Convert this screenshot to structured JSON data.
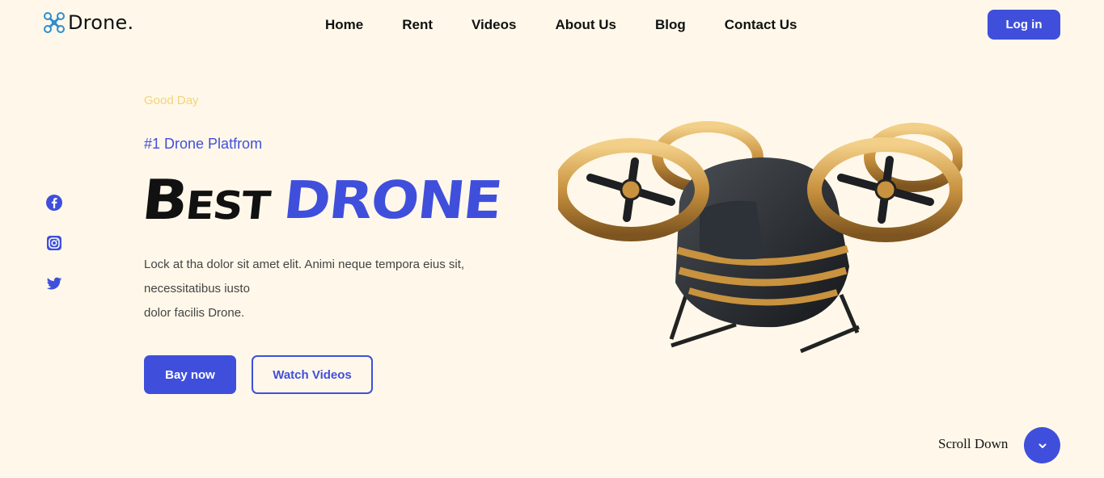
{
  "header": {
    "logo_text": "Drone.",
    "nav": [
      "Home",
      "Rent",
      "Videos",
      "About Us",
      "Blog",
      "Contact Us"
    ],
    "login_label": "Log in"
  },
  "social": [
    "facebook-icon",
    "instagram-icon",
    "twitter-icon"
  ],
  "hero": {
    "greeting": "Good Day",
    "tagline": "#1 Drone Platfrom",
    "headline_black": "Best",
    "headline_blue": "DRONE",
    "description_lines": [
      "Lock at tha dolor sit amet elit. Animi neque tempora eius sit,",
      "necessitatibus iusto",
      "dolor facilis Drone."
    ],
    "primary_button": "Bay now",
    "secondary_button": "Watch Videos"
  },
  "scroll": {
    "label": "Scroll Down"
  },
  "colors": {
    "accent": "#3f4fdc",
    "background": "#fff8ea",
    "greeting": "#f2d37a"
  }
}
